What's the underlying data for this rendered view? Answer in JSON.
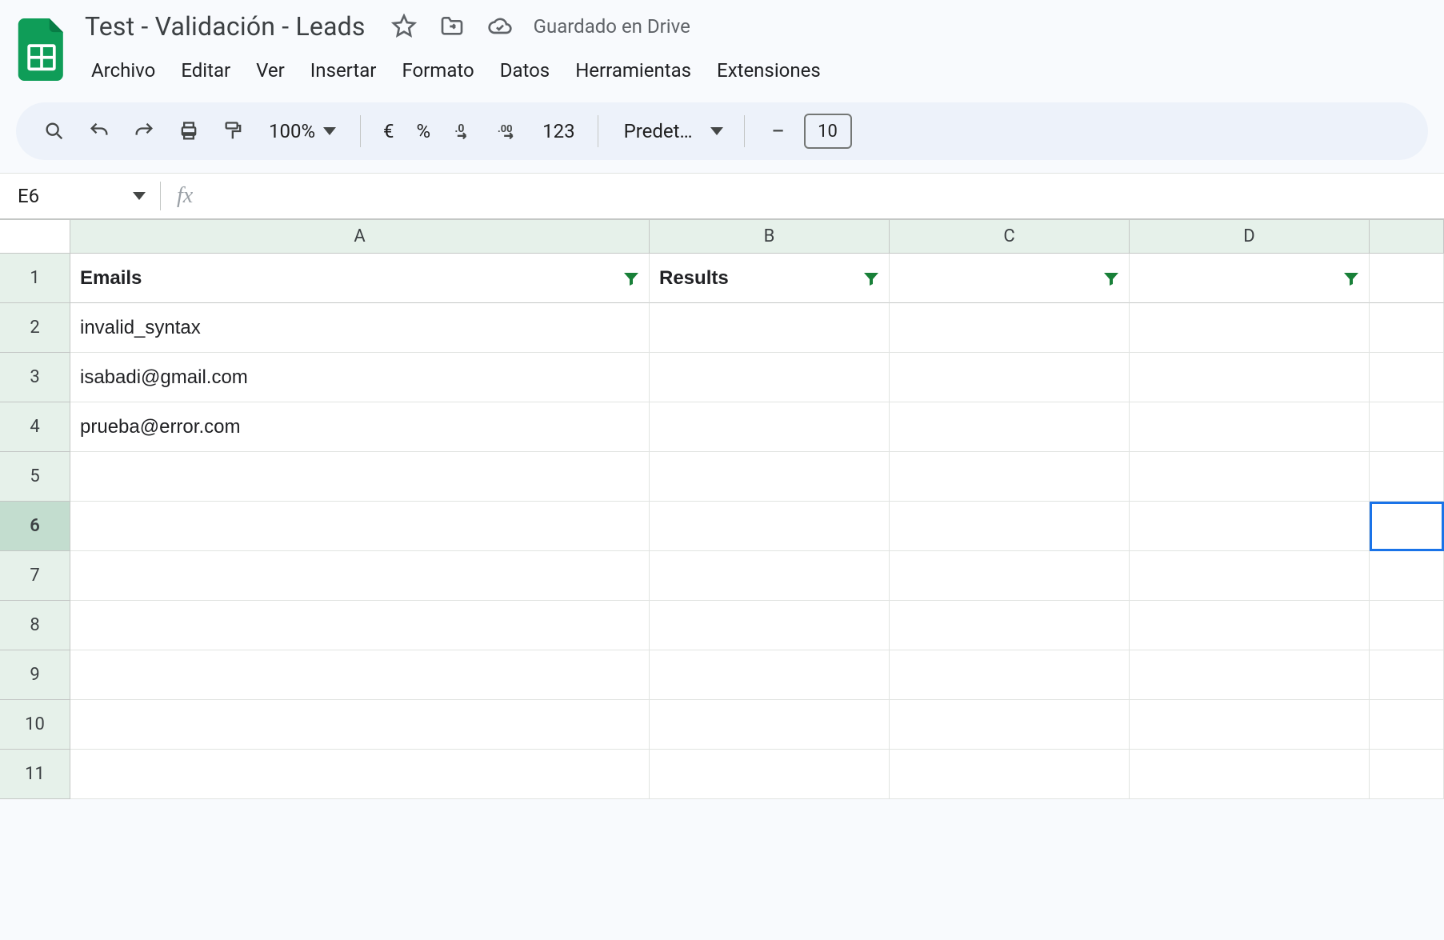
{
  "header": {
    "title": "Test - Validación - Leads",
    "save_status": "Guardado en Drive"
  },
  "menu": {
    "items": [
      "Archivo",
      "Editar",
      "Ver",
      "Insertar",
      "Formato",
      "Datos",
      "Herramientas",
      "Extensiones"
    ]
  },
  "toolbar": {
    "zoom": "100%",
    "currency": "€",
    "percent": "%",
    "number_format": "123",
    "font_name": "Predet…",
    "font_size": "10"
  },
  "name_box": {
    "value": "E6"
  },
  "formula_bar": {
    "value": ""
  },
  "grid": {
    "columns": [
      "A",
      "B",
      "C",
      "D"
    ],
    "rows": [
      {
        "n": "1",
        "A": "Emails",
        "B": "Results",
        "C": "",
        "D": "",
        "bold": true,
        "filter": true
      },
      {
        "n": "2",
        "A": "invalid_syntax",
        "B": "",
        "C": "",
        "D": ""
      },
      {
        "n": "3",
        "A": "isabadi@gmail.com",
        "B": "",
        "C": "",
        "D": ""
      },
      {
        "n": "4",
        "A": "prueba@error.com",
        "B": "",
        "C": "",
        "D": ""
      },
      {
        "n": "5",
        "A": "",
        "B": "",
        "C": "",
        "D": ""
      },
      {
        "n": "6",
        "A": "",
        "B": "",
        "C": "",
        "D": "",
        "active": true
      },
      {
        "n": "7",
        "A": "",
        "B": "",
        "C": "",
        "D": ""
      },
      {
        "n": "8",
        "A": "",
        "B": "",
        "C": "",
        "D": ""
      },
      {
        "n": "9",
        "A": "",
        "B": "",
        "C": "",
        "D": ""
      },
      {
        "n": "10",
        "A": "",
        "B": "",
        "C": "",
        "D": ""
      },
      {
        "n": "11",
        "A": "",
        "B": "",
        "C": "",
        "D": ""
      }
    ],
    "selected_cell": "E6"
  }
}
